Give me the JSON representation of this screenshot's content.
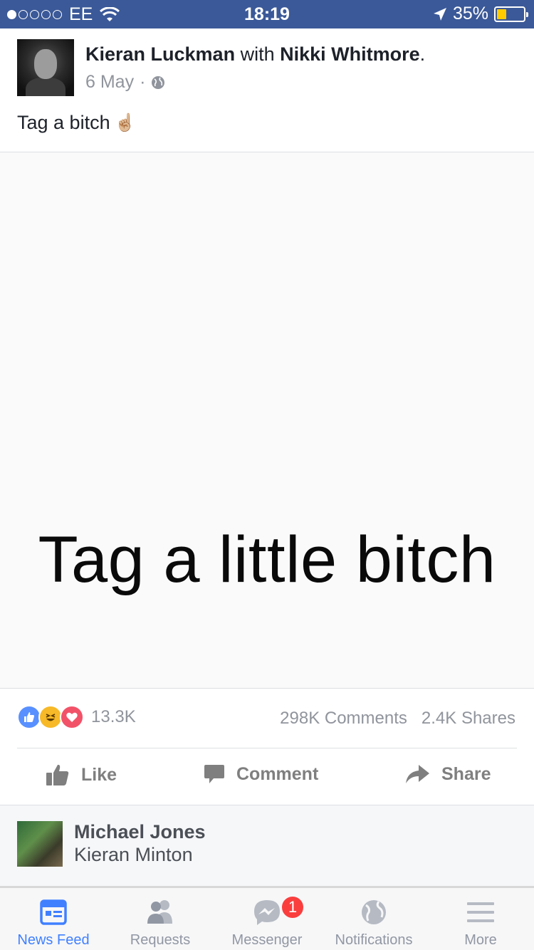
{
  "status_bar": {
    "carrier": "EE",
    "time": "18:19",
    "battery_percent": "35%",
    "battery_level": 0.35,
    "signal_bars": 1
  },
  "post": {
    "author": "Kieran Luckman",
    "with_word": "with",
    "tagged": "Nikki Whitmore",
    "date": "6 May",
    "separator": "·",
    "text": "Tag a bitch",
    "emoji": "☝🏼",
    "image_text": "Tag a little bitch"
  },
  "engagement": {
    "reaction_count": "13.3K",
    "comments": "298K Comments",
    "shares": "2.4K Shares",
    "reaction_icons": [
      "like-icon",
      "haha-icon",
      "love-icon"
    ]
  },
  "actions": {
    "like": "Like",
    "comment": "Comment",
    "share": "Share"
  },
  "comment_preview": {
    "name": "Michael Jones",
    "text": "Kieran Minton"
  },
  "tabbar": {
    "tabs": [
      {
        "label": "News Feed",
        "icon": "news-feed-icon",
        "active": true
      },
      {
        "label": "Requests",
        "icon": "requests-icon",
        "active": false
      },
      {
        "label": "Messenger",
        "icon": "messenger-icon",
        "active": false
      },
      {
        "label": "Notifications",
        "icon": "globe-icon",
        "active": false
      },
      {
        "label": "More",
        "icon": "menu-icon",
        "active": false
      }
    ],
    "messenger_badge": "1"
  },
  "colors": {
    "status_bar": "#3b5998",
    "active_tab": "#4080ff",
    "badge": "#fa3e3e",
    "battery_fill": "#ffcc00"
  }
}
